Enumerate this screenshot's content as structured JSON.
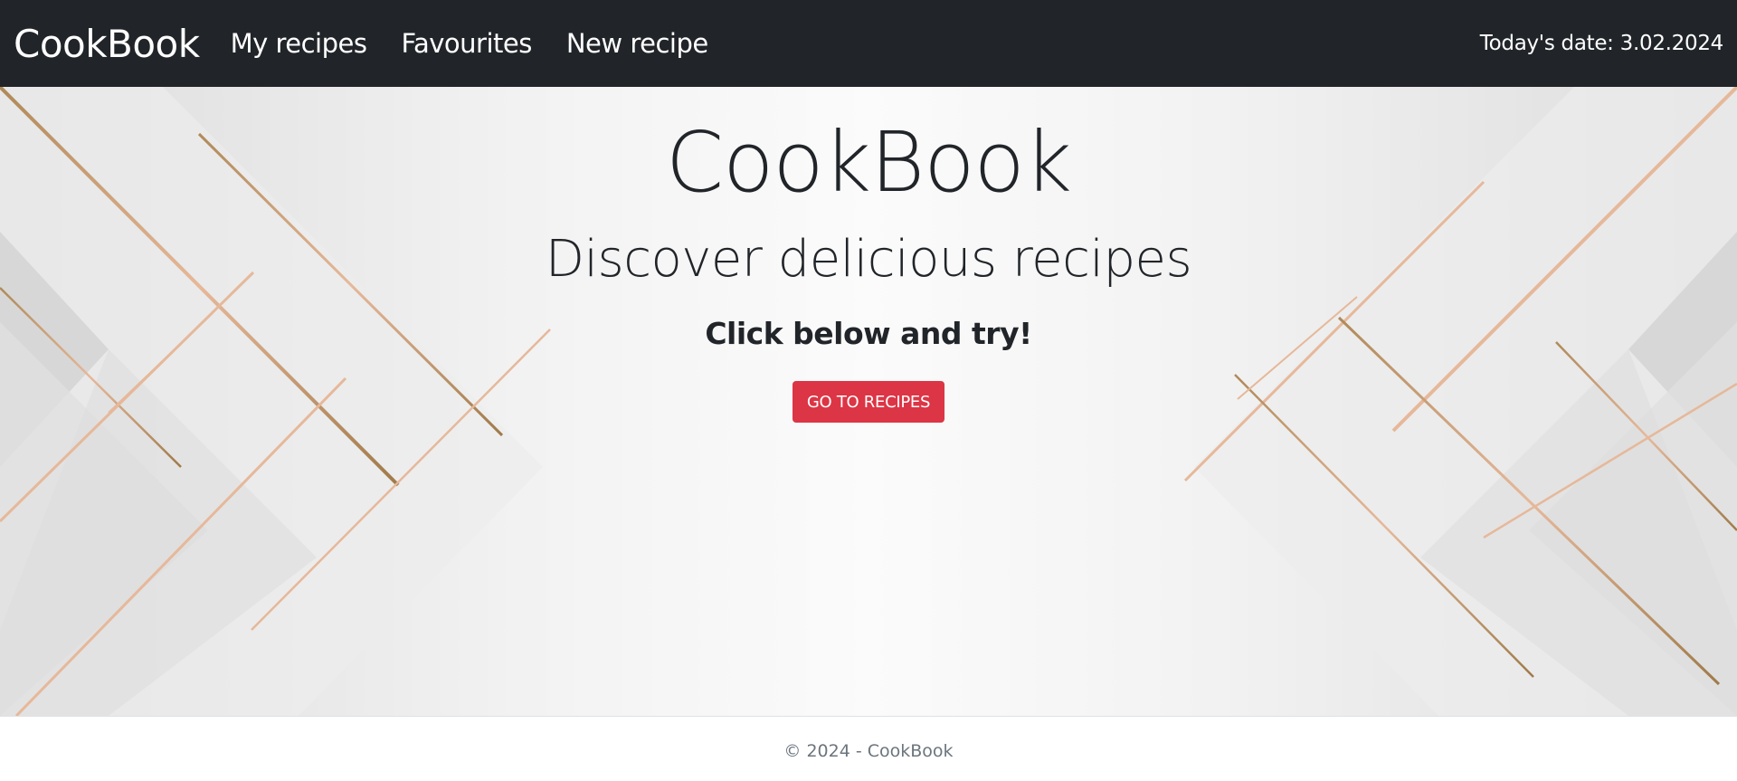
{
  "navbar": {
    "brand": "CookBook",
    "links": [
      {
        "label": "My recipes"
      },
      {
        "label": "Favourites"
      },
      {
        "label": "New recipe"
      }
    ],
    "date_text": "Today's date: 3.02.2024"
  },
  "hero": {
    "title": "CookBook",
    "subtitle": "Discover delicious recipes",
    "cta_text": "Click below and try!",
    "button_label": "GO TO RECIPES",
    "accent_color": "#dc3545"
  },
  "footer": {
    "text": "© 2024 - CookBook"
  }
}
